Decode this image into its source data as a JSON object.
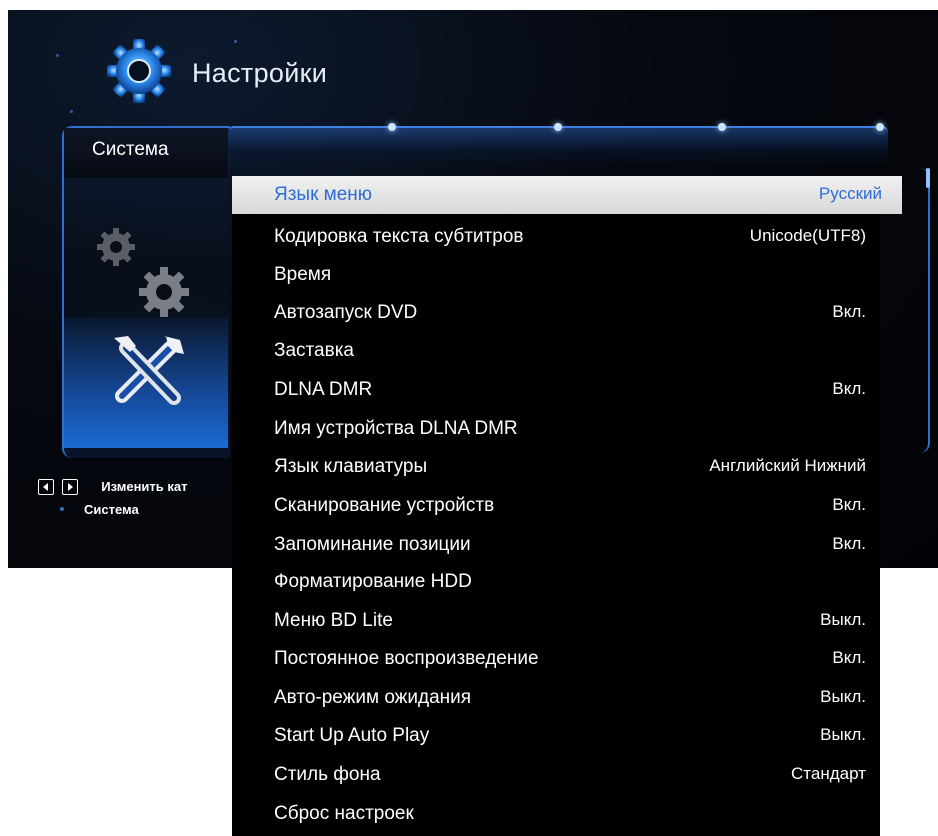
{
  "header": {
    "title": "Настройки",
    "icon": "gear-icon"
  },
  "sidebar": {
    "active_category": "Система",
    "hint": {
      "left_key": "arrow-left-key-icon",
      "right_key": "arrow-right-key-icon",
      "text": "Изменить кат",
      "sub": "Система"
    }
  },
  "settings": {
    "items": [
      {
        "label": "Язык меню",
        "value": "Русский",
        "selected": true
      },
      {
        "label": "Кодировка текста субтитров",
        "value": "Unicode(UTF8)"
      },
      {
        "label": "Время",
        "value": ""
      },
      {
        "label": "Автозапуск DVD",
        "value": "Вкл."
      },
      {
        "label": "Заставка",
        "value": ""
      },
      {
        "label": "DLNA DMR",
        "value": "Вкл."
      },
      {
        "label": "Имя устройства DLNA DMR",
        "value": ""
      },
      {
        "label": "Язык клавиатуры",
        "value": "Английский Нижний"
      },
      {
        "label": "Сканирование устройств",
        "value": "Вкл."
      },
      {
        "label": "Запоминание позиции",
        "value": "Вкл."
      },
      {
        "label": "Форматирование HDD",
        "value": ""
      },
      {
        "label": "Меню BD Lite",
        "value": "Выкл."
      },
      {
        "label": "Постоянное воспроизведение",
        "value": "Вкл."
      },
      {
        "label": "Авто-режим ожидания",
        "value": "Выкл."
      },
      {
        "label": "Start Up Auto Play",
        "value": "Выкл."
      },
      {
        "label": "Стиль фона",
        "value": "Стандарт"
      },
      {
        "label": "Сброс настроек",
        "value": ""
      }
    ]
  },
  "colors": {
    "selected_text": "#2e6cd6",
    "accent": "#2f6fce",
    "background": "#000000"
  }
}
